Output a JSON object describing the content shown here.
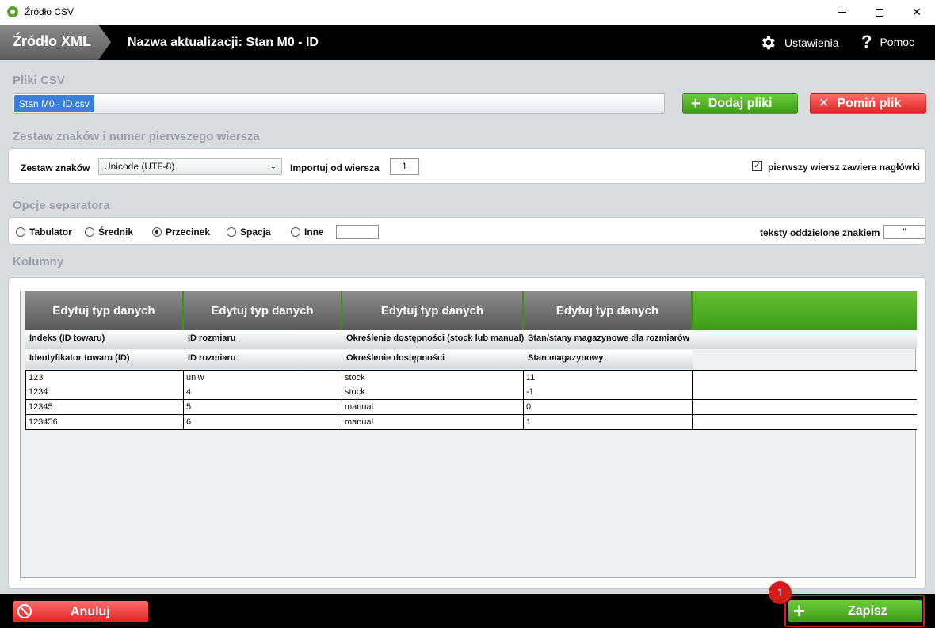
{
  "window": {
    "title": "Źródło CSV"
  },
  "header": {
    "tab_label": "Źródło XML",
    "update_name": "Nazwa aktualizacji: Stan M0 - ID",
    "settings_label": "Ustawienia",
    "help_label": "Pomoc"
  },
  "files": {
    "section_title": "Pliki CSV",
    "selected_file": "Stan M0 - ID.csv",
    "add_label": "Dodaj pliki",
    "skip_label": "Pomiń plik"
  },
  "charset": {
    "section_title": "Zestaw znaków i numer pierwszego wiersza",
    "charset_label": "Zestaw znaków",
    "charset_value": "Unicode (UTF-8)",
    "import_from_label": "Importuj od wiersza",
    "import_from_value": "1",
    "header_row_label": "pierwszy wiersz zawiera nagłówki",
    "header_row_checked": true
  },
  "separator": {
    "section_title": "Opcje separatora",
    "options": [
      "Tabulator",
      "Średnik",
      "Przecinek",
      "Spacja",
      "Inne"
    ],
    "selected": "Przecinek",
    "other_value": "",
    "quote_label": "teksty oddzielone znakiem",
    "quote_value": "\""
  },
  "columns": {
    "section_title": "Kolumny",
    "edit_labels": [
      "Edytuj typ danych",
      "Edytuj typ danych",
      "Edytuj typ danych",
      "Edytuj typ danych"
    ],
    "target_headers": [
      "Indeks (ID towaru)",
      "ID rozmiaru",
      "Określenie dostępności (stock lub manual)",
      "Stan/stany magazynowe dla rozmiarów"
    ],
    "source_headers": [
      "Identyfikator towaru (ID)",
      "ID rozmiaru",
      "Określenie dostępności",
      "Stan magazynowy"
    ],
    "rows": [
      [
        "123",
        "uniw",
        "stock",
        "11"
      ],
      [
        "1234",
        "4",
        "stock",
        "-1"
      ],
      [
        "12345",
        "5",
        "manual",
        "0"
      ],
      [
        "123456",
        "6",
        "manual",
        "1"
      ]
    ]
  },
  "footer": {
    "cancel_label": "Anuluj",
    "save_label": "Zapisz",
    "step_badge": "1"
  },
  "colors": {
    "accent_green": "#4caf24",
    "danger_red": "#e53030",
    "highlight_red": "#d51b1b",
    "header_bg": "#000000"
  }
}
